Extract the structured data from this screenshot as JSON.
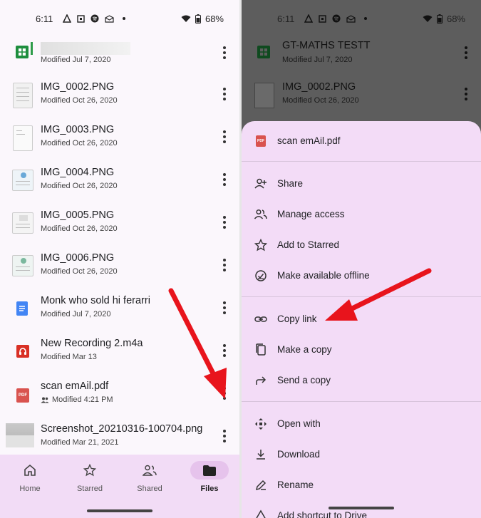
{
  "status": {
    "time": "6:11",
    "battery": "68%"
  },
  "left": {
    "files": [
      {
        "title": "",
        "subtitle": "Modified Jul 7, 2020",
        "icon": "sheets-icon"
      },
      {
        "title": "IMG_0002.PNG",
        "subtitle": "Modified Oct 26, 2020",
        "icon": "image-thumbnail"
      },
      {
        "title": "IMG_0003.PNG",
        "subtitle": "Modified Oct 26, 2020",
        "icon": "image-thumbnail"
      },
      {
        "title": "IMG_0004.PNG",
        "subtitle": "Modified Oct 26, 2020",
        "icon": "image-thumbnail"
      },
      {
        "title": "IMG_0005.PNG",
        "subtitle": "Modified Oct 26, 2020",
        "icon": "image-thumbnail"
      },
      {
        "title": "IMG_0006.PNG",
        "subtitle": "Modified Oct 26, 2020",
        "icon": "image-thumbnail"
      },
      {
        "title": "Monk who sold hi ferarri",
        "subtitle": "Modified Jul 7, 2020",
        "icon": "docs-icon"
      },
      {
        "title": "New Recording 2.m4a",
        "subtitle": "Modified Mar 13",
        "icon": "audio-icon"
      },
      {
        "title": "scan emAil.pdf",
        "subtitle": "Modified 4:21 PM",
        "icon": "pdf-icon"
      },
      {
        "title": "Screenshot_20210316-100704.png",
        "subtitle": "Modified Mar 21, 2021",
        "icon": "image-thumbnail"
      }
    ],
    "pdf_label": "PDF",
    "nav": [
      {
        "label": "Home",
        "icon": "home-icon"
      },
      {
        "label": "Starred",
        "icon": "star-icon"
      },
      {
        "label": "Shared",
        "icon": "shared-icon"
      },
      {
        "label": "Files",
        "icon": "folder-icon"
      }
    ]
  },
  "right": {
    "bg_files": [
      {
        "title": "GT-MATHS TESTT",
        "subtitle": "Modified Jul 7, 2020"
      },
      {
        "title": "IMG_0002.PNG",
        "subtitle": "Modified Oct 26, 2020"
      }
    ],
    "sheet": {
      "file_name": "scan emAil.pdf",
      "group1": [
        {
          "label": "Share",
          "icon": "person-add-icon"
        },
        {
          "label": "Manage access",
          "icon": "people-icon"
        },
        {
          "label": "Add to Starred",
          "icon": "star-outline-icon"
        },
        {
          "label": "Make available offline",
          "icon": "offline-icon"
        }
      ],
      "group2": [
        {
          "label": "Copy link",
          "icon": "link-icon"
        },
        {
          "label": "Make a copy",
          "icon": "copy-icon"
        },
        {
          "label": "Send a copy",
          "icon": "send-icon"
        }
      ],
      "group3": [
        {
          "label": "Open with",
          "icon": "open-with-icon"
        },
        {
          "label": "Download",
          "icon": "download-icon"
        },
        {
          "label": "Rename",
          "icon": "rename-icon"
        },
        {
          "label": "Add shortcut to Drive",
          "icon": "shortcut-icon"
        }
      ]
    }
  },
  "colors": {
    "accent_bg": "#f3dcf7",
    "arrow_red": "#e8141c"
  }
}
